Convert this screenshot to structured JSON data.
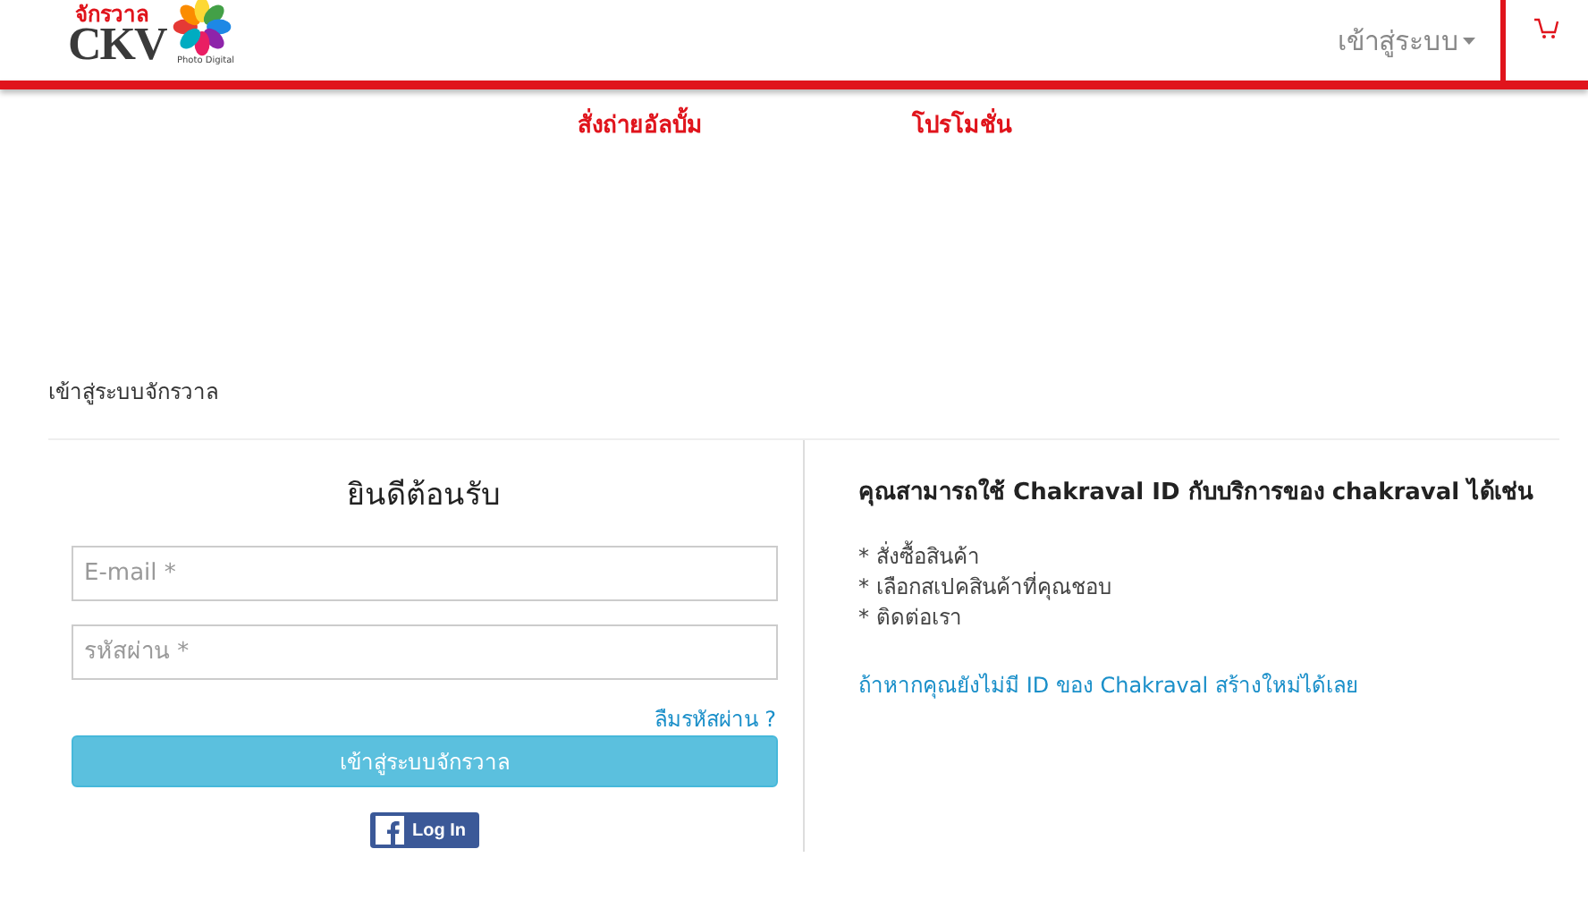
{
  "header": {
    "logo": {
      "thai": "จักรวาล",
      "brand": "CKV",
      "tagline": "Photo Digital"
    },
    "login_menu": "เข้าสู่ระบบ"
  },
  "nav": [
    "สั่งถ่ายอัลบั้ม",
    "โปรโมชั่น"
  ],
  "breadcrumb": "เข้าสู่ระบบจักรวาล",
  "login_form": {
    "title": "ยินดีต้อนรับ",
    "email": {
      "placeholder": "E-mail *"
    },
    "password": {
      "placeholder": "รหัสผ่าน *"
    },
    "forgot": "ลืมรหัสผ่าน ?",
    "submit": "เข้าสู่ระบบจักรวาล",
    "facebook": "Log In"
  },
  "info": {
    "heading": "คุณสามารถใช้ Chakraval ID กับบริการของ chakraval ได้เช่น",
    "items": [
      "* สั่งซื้อสินค้า",
      "* เลือกสเปคสินค้าที่คุณชอบ",
      "* ติดต่อเรา"
    ],
    "signup_link": "ถ้าหากคุณยังไม่มี ID ของ Chakraval สร้างใหม่ได้เลย"
  }
}
